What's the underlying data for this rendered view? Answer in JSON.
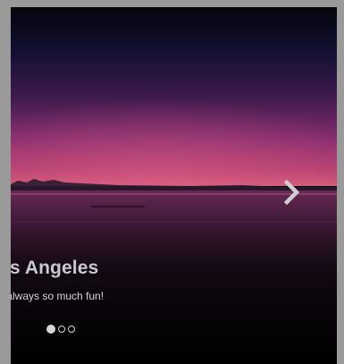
{
  "carousel": {
    "slide": {
      "title": "os Angeles",
      "text": "s always so much fun!",
      "image_icon": "sunset-lake-image"
    },
    "next_icon": "chevron-right-icon",
    "indicators": [
      {
        "active": true
      },
      {
        "active": false
      },
      {
        "active": false
      }
    ]
  },
  "colors": {
    "frame": "#9a9a9a",
    "sky_top": "#07060f",
    "sky_glow": "#7a2a6a",
    "horizon": "#c44a7a",
    "water": "#1a0f1c",
    "caption_text": "#c9c9cf"
  }
}
